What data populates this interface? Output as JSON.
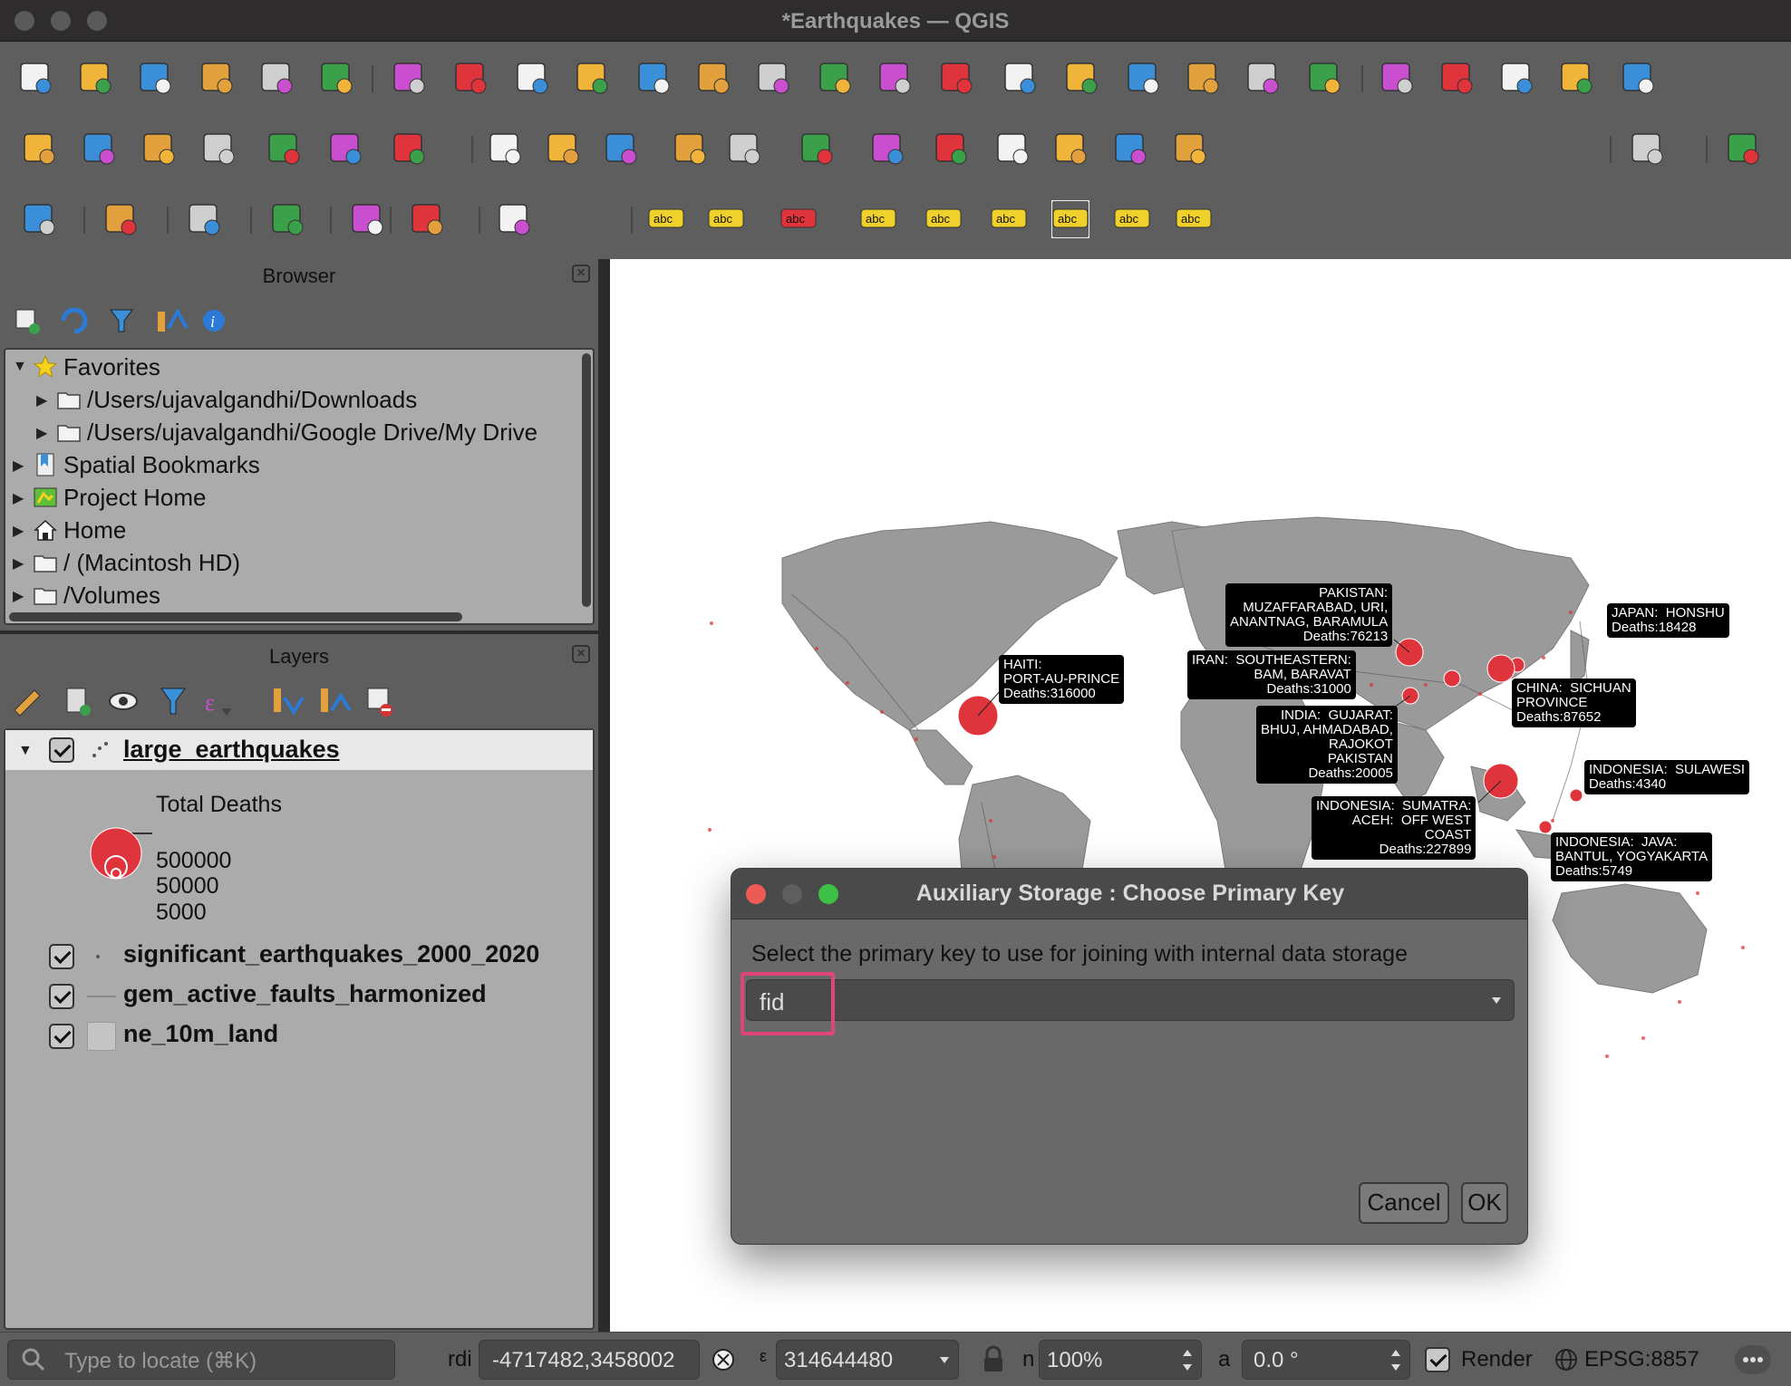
{
  "window": {
    "title": "*Earthquakes — QGIS"
  },
  "colors": {
    "accent": "#e0457a",
    "marker": "#e0343c",
    "land": "#9a9a9a",
    "panel": "#5e5e5e"
  },
  "toolbar_rows": [
    [
      "new-project-icon",
      "open-project-icon",
      "save-project-icon",
      "new-print-layout-icon",
      "layout-manager-icon",
      "style-manager-icon",
      "pan-icon",
      "pan-to-selection-icon",
      "zoom-in-icon",
      "zoom-out-icon",
      "zoom-full-icon",
      "zoom-to-selection-icon",
      "zoom-to-layer-icon",
      "zoom-native-icon",
      "zoom-last-icon",
      "zoom-next-icon",
      "new-map-view-icon",
      "new-3d-map-view-icon",
      "new-bookmark-icon",
      "show-bookmarks-icon",
      "temporal-controller-icon",
      "refresh-icon",
      "identify-features-icon",
      "attribute-summary-icon",
      "settings-icon",
      "statistics-sigma-icon",
      "attribute-table-icon"
    ],
    [
      "data-source-manager-icon",
      "new-geopackage-layer-icon",
      "new-shapefile-layer-icon",
      "new-temporary-scratch-layer-icon",
      "new-virtual-layer-icon",
      "new-mesh-layer-icon",
      "digitize-vertex-icon",
      "current-edits-icon",
      "toggle-editing-icon",
      "save-layer-edits-icon",
      "add-feature-icon",
      "vertex-tool-icon",
      "modify-attributes-icon",
      "delete-selected-icon",
      "cut-features-icon",
      "copy-features-icon",
      "paste-features-icon",
      "undo-icon",
      "redo-icon",
      "web-services-icon",
      "help-icon"
    ],
    [
      "select-features-icon",
      "select-by-value-icon",
      "deselect-all-icon",
      "select-location-icon",
      "measure-line-icon",
      "identify-icon",
      "expression-icon",
      "label-toolbar-icon",
      "layer-labeling-icon",
      "layer-diagram-icon",
      "highlight-pinned-labels-icon",
      "pin-unpin-labels-icon",
      "show-hide-labels-icon",
      "move-label-icon",
      "rotate-label-icon",
      "change-label-icon"
    ]
  ],
  "browser": {
    "title": "Browser",
    "items": [
      {
        "label": "Favorites",
        "icon": "star-icon",
        "indent": 0
      },
      {
        "label": "/Users/ujavalgandhi/Downloads",
        "icon": "folder-icon",
        "indent": 1
      },
      {
        "label": "/Users/ujavalgandhi/Google Drive/My Drive",
        "icon": "folder-icon",
        "indent": 1
      },
      {
        "label": "Spatial Bookmarks",
        "icon": "bookmark-icon",
        "indent": 0
      },
      {
        "label": "Project Home",
        "icon": "project-home-icon",
        "indent": 0
      },
      {
        "label": "Home",
        "icon": "home-icon",
        "indent": 0
      },
      {
        "label": "/ (Macintosh HD)",
        "icon": "folder-icon",
        "indent": 0
      },
      {
        "label": "/Volumes",
        "icon": "folder-icon",
        "indent": 0
      }
    ]
  },
  "layers": {
    "title": "Layers",
    "items": [
      {
        "name": "large_earthquakes",
        "checked": true,
        "expanded": true
      },
      {
        "name": "significant_earthquakes_2000_2020",
        "checked": true
      },
      {
        "name": "gem_active_faults_harmonized",
        "checked": true
      },
      {
        "name": "ne_10m_land",
        "checked": true
      }
    ],
    "legend": {
      "title": "Total Deaths",
      "sizes": [
        "500000",
        "50000",
        "5000"
      ]
    }
  },
  "map": {
    "labels": [
      {
        "text": "PAKISTAN:\nMUZAFFARABAD, URI,\nANANTNAG, BARAMULA\nDeaths:76213"
      },
      {
        "text": "JAPAN:  HONSHU\nDeaths:18428"
      },
      {
        "text": "HAITI:\nPORT-AU-PRINCE\nDeaths:316000"
      },
      {
        "text": "IRAN:  SOUTHEASTERN:\nBAM, BARAVAT\nDeaths:31000"
      },
      {
        "text": "CHINA:  SICHUAN\nPROVINCE\nDeaths:87652"
      },
      {
        "text": "INDIA:  GUJARAT:\nBHUJ, AHMADABAD,\nRAJOKOT\nPAKISTAN\nDeaths:20005"
      },
      {
        "text": "INDONESIA:  SULAWESI\nDeaths:4340"
      },
      {
        "text": "INDONESIA:  SUMATRA:\nACEH:  OFF WEST\nCOAST\nDeaths:227899"
      },
      {
        "text": "INDONESIA:  JAVA:\nBANTUL, YOGYAKARTA\nDeaths:5749"
      }
    ]
  },
  "dialog": {
    "title": "Auxiliary Storage : Choose Primary Key",
    "prompt": "Select the primary key to use for joining with internal data storage",
    "selected_key": "fid",
    "cancel_label": "Cancel",
    "ok_label": "OK"
  },
  "statusbar": {
    "locate_placeholder": "Type to locate (⌘K)",
    "coordinate_label": "rdi",
    "coordinate_value": "-4717482,3458002",
    "scale_label": "ε",
    "scale_value": "314644480",
    "magnifier_label": "n",
    "magnifier_value": "100%",
    "rotation_label": "a",
    "rotation_value": "0.0 °",
    "render_label": "Render",
    "crs_label": "EPSG:8857"
  }
}
